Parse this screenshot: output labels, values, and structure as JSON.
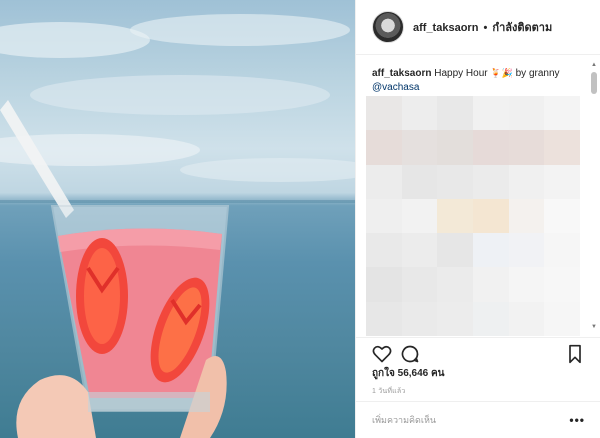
{
  "post": {
    "username": "aff_taksaorn",
    "separator": "•",
    "follow_status": "กำลังติดตาม",
    "caption_user": "aff_taksaorn",
    "caption_text": "Happy Hour",
    "caption_by": "by granny",
    "caption_mention": "@vachasa",
    "likes_label": "ถูกใจ 56,646 คน",
    "time_ago": "1 วันที่แล้ว",
    "comment_placeholder": "เพิ่มความคิดเห็น",
    "more_label": "•••"
  },
  "icons": {
    "heart": "heart-icon",
    "comment": "comment-icon",
    "bookmark": "bookmark-icon",
    "emoji1": "tropical-drink-emoji",
    "emoji2": "party-emoji"
  },
  "blur_colors": [
    "#e9e7e6",
    "#ededed",
    "#e8e8e8",
    "#f1f1f1",
    "#f0f0f0",
    "#f4f4f4",
    "#e6dcd9",
    "#e5e0de",
    "#e3dedb",
    "#e6dad8",
    "#e7dcd9",
    "#ece1dc",
    "#ececec",
    "#e6e6e6",
    "#e8e8e8",
    "#ebebeb",
    "#f0f0f0",
    "#f3f3f3",
    "#efefef",
    "#f2f2f2",
    "#f3e9d7",
    "#f4e6d2",
    "#f4f1ee",
    "#f8f8f8",
    "#e9e9e9",
    "#ececec",
    "#e6e6e6",
    "#eef1f5",
    "#f1f2f5",
    "#f6f6f6",
    "#e4e4e4",
    "#e8e8e8",
    "#ebebeb",
    "#f1f1f1",
    "#f5f5f5",
    "#f7f7f7",
    "#e7e7e7",
    "#eaeaea",
    "#ececec",
    "#eef0f1",
    "#f2f2f2",
    "#f6f6f6"
  ]
}
